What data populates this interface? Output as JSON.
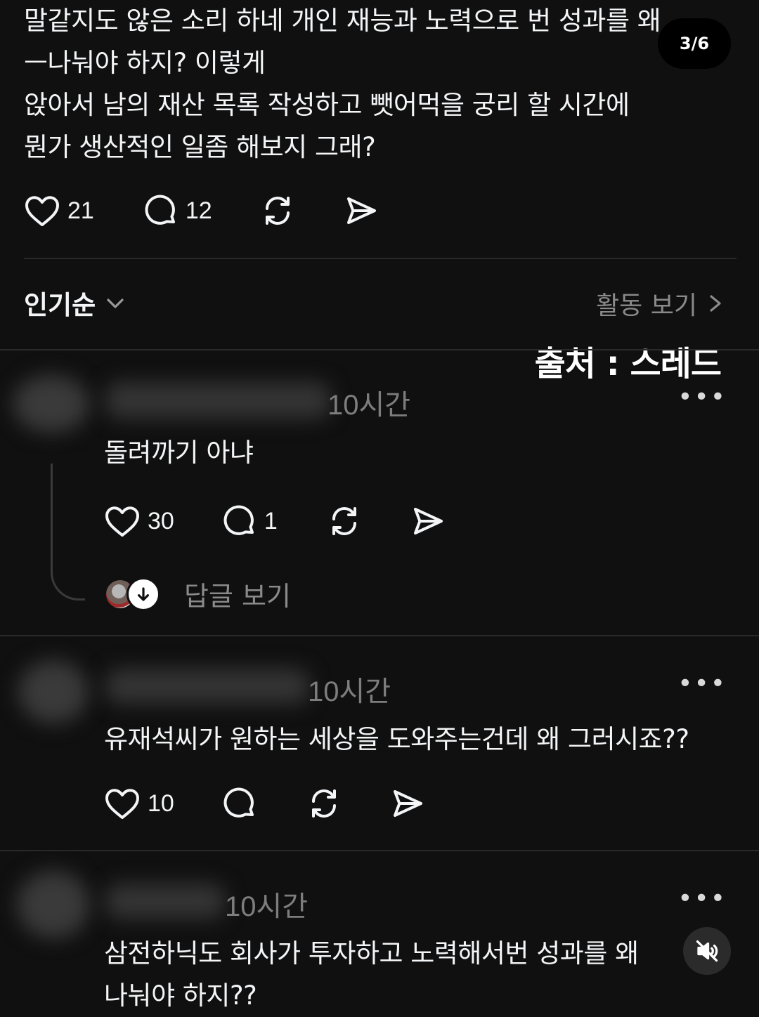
{
  "post": {
    "lines": [
      "말같지도 않은 소리 하네 개인 재능과 노력으로 번 성과를 왜",
      "ㅡ나눠야 하지?  이렇게",
      "앉아서 남의 재산 목록 작성하고 뺏어먹을 궁리 할 시간에",
      "뭔가 생산적인 일좀 해보지 그래?"
    ],
    "pager": "3/6",
    "likes": "21",
    "comments": "12",
    "icons": [
      "heart-icon",
      "comment-icon",
      "repost-icon",
      "share-icon"
    ]
  },
  "sort": {
    "label": "인기순",
    "activity_link": "활동 보기"
  },
  "watermark": "출처 : 스레드",
  "comments": [
    {
      "time": "10시간",
      "text": "돌려까기 아냐",
      "likes": "30",
      "replies": "1",
      "view_replies": "답글 보기"
    },
    {
      "time": "10시간",
      "text": "유재석씨가 원하는 세상을 도와주는건데 왜 그러시죠??",
      "likes": "10",
      "replies": ""
    },
    {
      "time": "10시간",
      "lines": [
        "삼전하닉도 회사가 투자하고 노력해서번 성과를 왜",
        "나눠야 하지??"
      ]
    }
  ],
  "colors": {
    "background": "#101010",
    "text": "#f3f5f7",
    "muted": "#8a8a8a",
    "divider": "#2a2a2a"
  }
}
